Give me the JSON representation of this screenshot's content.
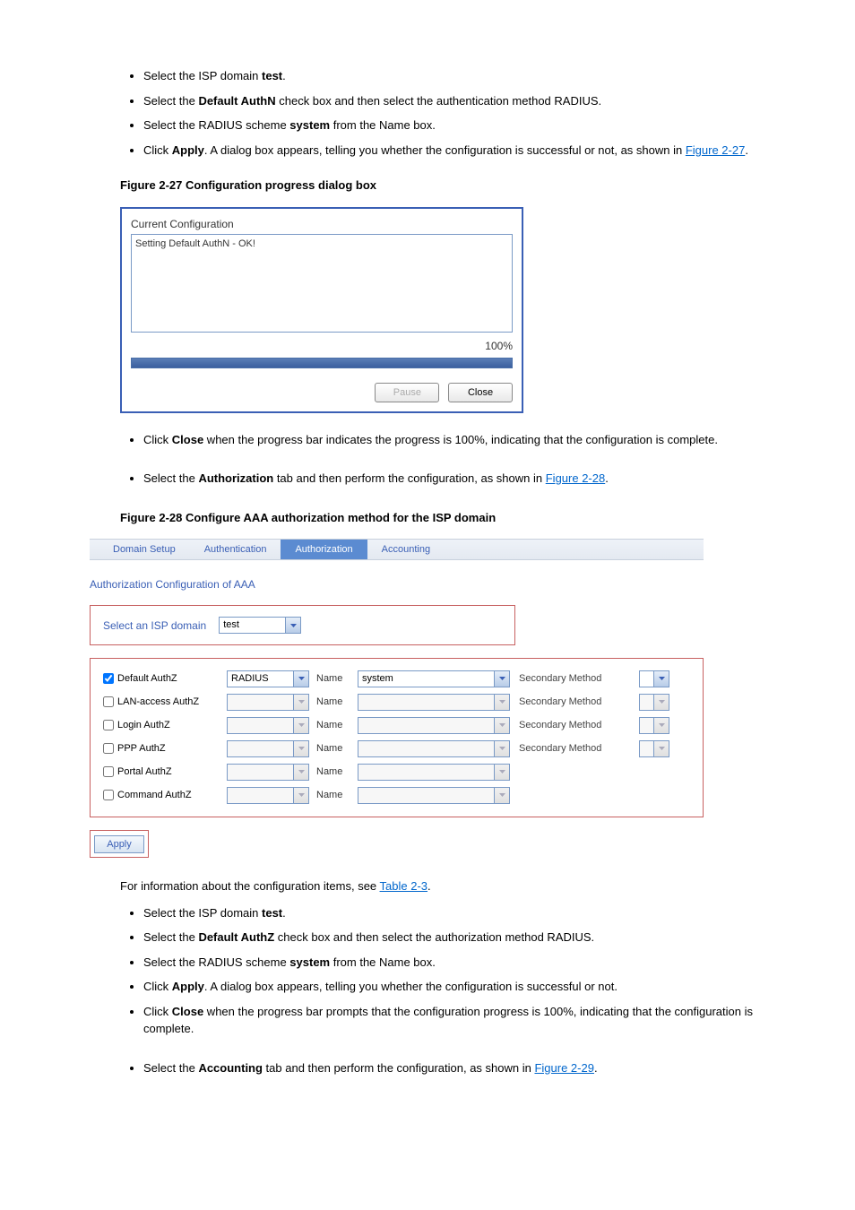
{
  "bullets1": [
    {
      "pre": "Select the ISP domain ",
      "bold": "test",
      "post": "."
    },
    {
      "pre": "Select the ",
      "bold": "Default AuthN",
      "post": " check box and then select the authentication method RADIUS."
    },
    {
      "pre": "Select the RADIUS scheme ",
      "bold": "system",
      "post": " from the Name box."
    },
    {
      "pre": "Click ",
      "bold": "Apply",
      "post1": ". A dialog box appears, telling you whether the configuration is successful or not, as shown in ",
      "link": "Figure 2-27",
      "post2": "."
    }
  ],
  "popup": {
    "title": "Current Configuration",
    "log": "Setting Default AuthN - OK!",
    "percent": "100%",
    "pause": "Pause",
    "close": "Close"
  },
  "fig27": "Figure 2-27 Configuration progress dialog box",
  "bullets2": [
    {
      "pre": "Click ",
      "bold": "Close",
      "post": " when the progress bar indicates the progress is 100%, indicating that the configuration is complete."
    },
    {
      "pre": "Select the ",
      "bold": "Authorization",
      "post1": " tab and then perform the configuration, as shown in ",
      "link": "Figure 2-28",
      "post2": "."
    }
  ],
  "fig28": "Figure 2-28 Configure AAA authorization method for the ISP domain",
  "tabset": {
    "domain": "Domain Setup",
    "authn": "Authentication",
    "authz": "Authorization",
    "acct": "Accounting"
  },
  "section": "Authorization Configuration of AAA",
  "selectIsp": "Select an ISP domain",
  "ispVal": "test",
  "rows": {
    "default": {
      "label": "Default AuthZ",
      "checked": true,
      "method": "RADIUS",
      "nameVal": "system"
    },
    "lan": {
      "label": "LAN-access AuthZ"
    },
    "login": {
      "label": "Login AuthZ"
    },
    "ppp": {
      "label": "PPP AuthZ"
    },
    "portal": {
      "label": "Portal AuthZ"
    },
    "command": {
      "label": "Command AuthZ"
    }
  },
  "name": "Name",
  "secMethod": "Secondary Method",
  "apply": "Apply",
  "tableRef": {
    "pre": "For information about the configuration items, see ",
    "link": "Table 2-3",
    "post": "."
  },
  "bullets3": [
    {
      "pre": "Select the ISP domain ",
      "bold": "test",
      "post": "."
    },
    {
      "pre": "Select the ",
      "bold": "Default AuthZ",
      "post": " check box and then select the authorization method RADIUS."
    },
    {
      "pre": "Select the RADIUS scheme ",
      "bold": "system",
      "post": " from the Name box."
    },
    {
      "pre": "Click ",
      "bold": "Apply",
      "post": ". A dialog box appears, telling you whether the configuration is successful or not."
    },
    {
      "pre": "Click ",
      "bold": "Close",
      "post": " when the progress bar prompts that the configuration progress is 100%, indicating that the configuration is complete."
    },
    {
      "pre": "Select the ",
      "bold": "Accounting",
      "post1": " tab and then perform the configuration, as shown in ",
      "link": "Figure 2-29",
      "post2": "."
    }
  ]
}
